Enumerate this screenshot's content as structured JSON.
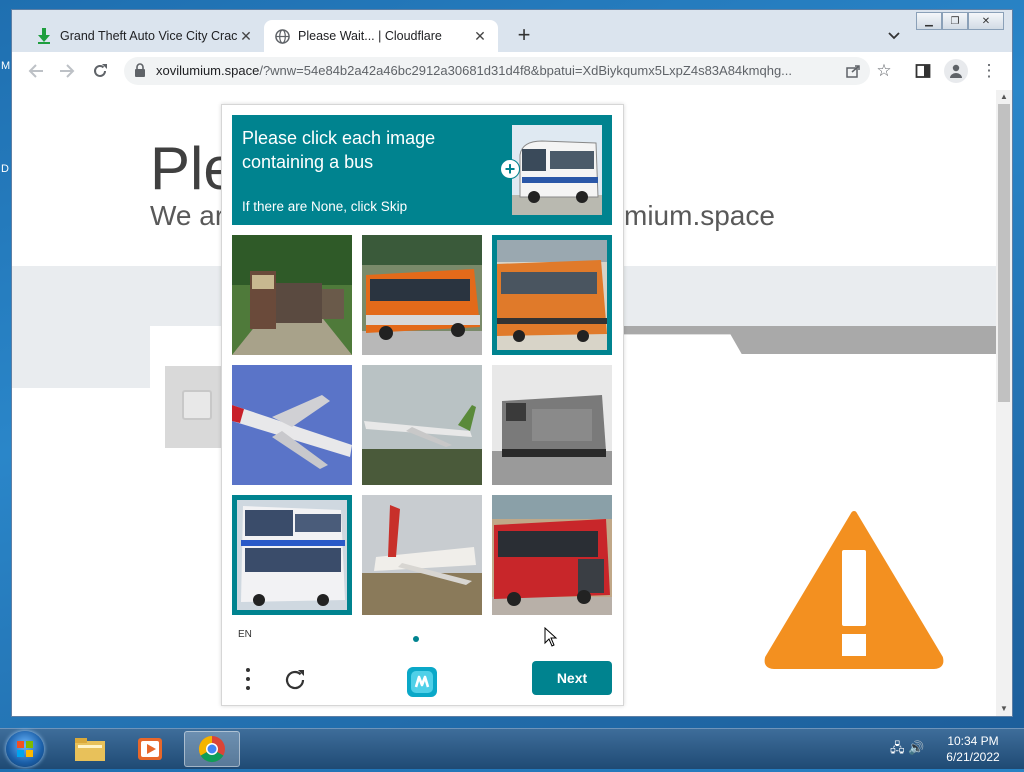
{
  "desktop": {
    "frag_top": "M",
    "frag_mid": "D"
  },
  "browser": {
    "tabs": [
      {
        "title": "Grand Theft Auto Vice City Crack",
        "favicon": "download-arrow-icon",
        "active": false
      },
      {
        "title": "Please Wait... | Cloudflare",
        "favicon": "globe-icon",
        "active": true
      }
    ],
    "new_tab": "+",
    "url_host": "xovilumium.space",
    "url_path": "/?wnw=54e84b2a42a46bc2912a30681d31d4f8&bpatui=XdBiykqumx5LxpZ4s83A84kmqhg..."
  },
  "page": {
    "heading_fragment": "Ple",
    "sub_fragment_left": "We ar",
    "sub_fragment_right": "mium.space"
  },
  "captcha": {
    "prompt": "Please click each image containing a bus",
    "skip_hint": "If there are None, click Skip",
    "language": "EN",
    "next_label": "Next",
    "accent_color": "#00838f",
    "tiles": [
      {
        "content": "freight train in forest",
        "selected": false
      },
      {
        "content": "orange bus",
        "selected": false
      },
      {
        "content": "orange bus",
        "selected": true
      },
      {
        "content": "airplane in sky",
        "selected": false
      },
      {
        "content": "airplane landing",
        "selected": false
      },
      {
        "content": "locomotive",
        "selected": false
      },
      {
        "content": "double-decker bus",
        "selected": true
      },
      {
        "content": "airplane on runway",
        "selected": false
      },
      {
        "content": "red bus",
        "selected": false
      }
    ]
  },
  "taskbar": {
    "time": "10:34 PM",
    "date": "6/21/2022"
  }
}
